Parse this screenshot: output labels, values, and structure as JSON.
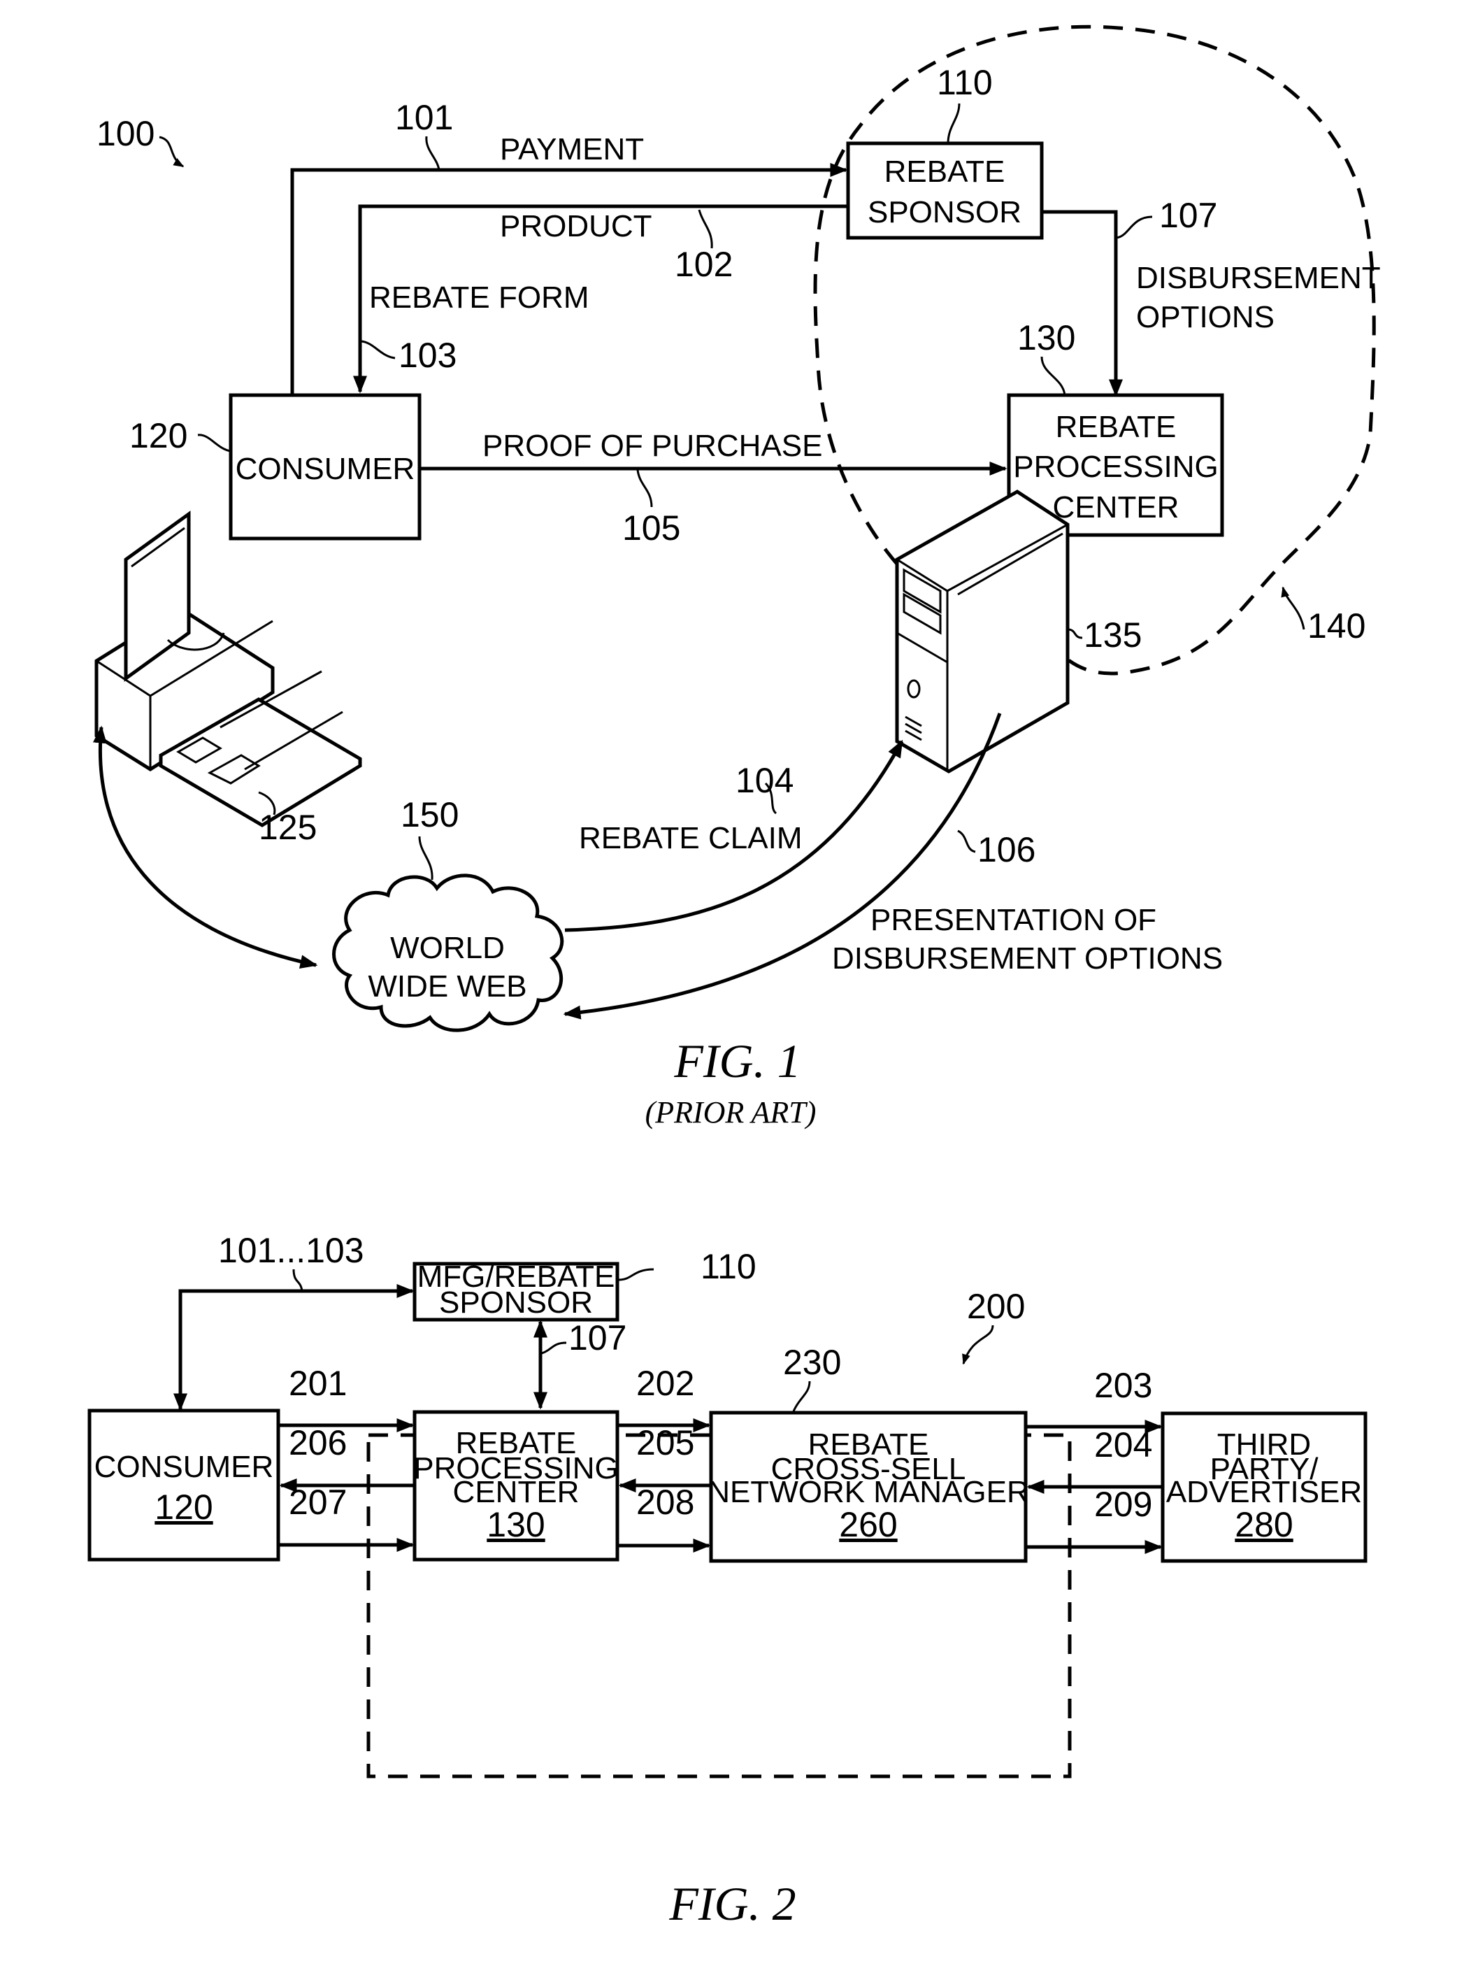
{
  "fig1": {
    "ref_system": "100",
    "caption": "FIG. 1",
    "subcaption": "(PRIOR ART)",
    "consumer": {
      "label": "CONSUMER",
      "ref": "120"
    },
    "rebate_sponsor": {
      "lines": [
        "REBATE",
        "SPONSOR"
      ],
      "ref": "110"
    },
    "rebate_processing_center": {
      "lines": [
        "REBATE",
        "PROCESSING",
        "CENTER"
      ],
      "ref": "130"
    },
    "server": {
      "ref": "135"
    },
    "computer": {
      "ref": "125"
    },
    "internet": {
      "lines": [
        "WORLD",
        "WIDE WEB"
      ],
      "ref": "150"
    },
    "boundary": {
      "ref": "140"
    },
    "flows": [
      {
        "ref": "101",
        "label": "PAYMENT"
      },
      {
        "ref": "102",
        "label": "PRODUCT"
      },
      {
        "ref": "103",
        "label": "REBATE FORM"
      },
      {
        "ref": "104",
        "label": "REBATE CLAIM"
      },
      {
        "ref": "105",
        "label": "PROOF OF PURCHASE"
      },
      {
        "ref": "106",
        "lines": [
          "PRESENTATION OF",
          "DISBURSEMENT OPTIONS"
        ]
      },
      {
        "ref": "107",
        "lines": [
          "DISBURSEMENT",
          "OPTIONS"
        ]
      }
    ]
  },
  "fig2": {
    "ref_system": "200",
    "caption": "FIG. 2",
    "group_ref": "230",
    "sponsor": {
      "lines": [
        "MFG/REBATE",
        "SPONSOR"
      ],
      "ref": "110"
    },
    "consumer": {
      "label": "CONSUMER",
      "ref": "120"
    },
    "rebate_processing_center": {
      "lines": [
        "REBATE",
        "PROCESSING",
        "CENTER"
      ],
      "ref": "130"
    },
    "cross_sell_manager": {
      "lines": [
        "REBATE",
        "CROSS-SELL",
        "NETWORK MANAGER"
      ],
      "ref": "260"
    },
    "third_party": {
      "lines": [
        "THIRD",
        "PARTY/",
        "ADVERTISER"
      ],
      "ref": "280"
    },
    "flow_refs": {
      "sponsor_link": "101...103",
      "sponsor_rpc": "107",
      "f201": "201",
      "f202": "202",
      "f203": "203",
      "f204": "204",
      "f205": "205",
      "f206": "206",
      "f207": "207",
      "f208": "208",
      "f209": "209"
    }
  }
}
